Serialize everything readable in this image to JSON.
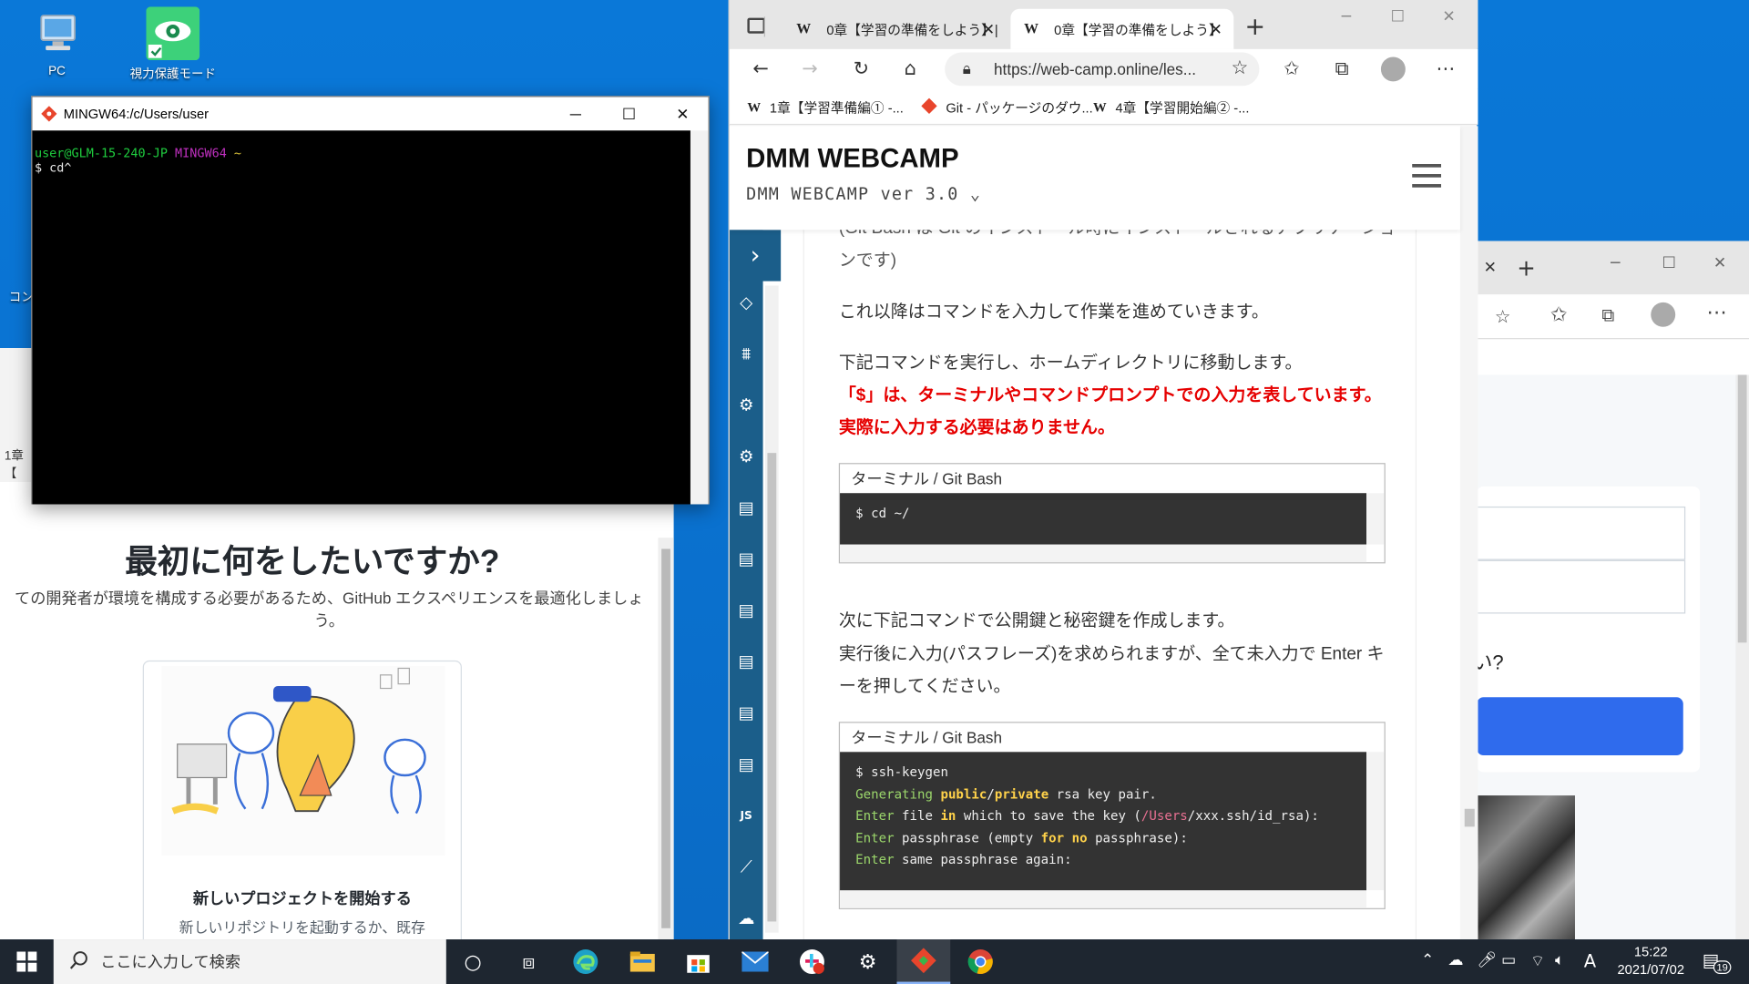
{
  "desktop": {
    "icons": [
      {
        "label": "PC",
        "icon": "computer-icon"
      },
      {
        "label": "視力保護モード",
        "icon": "eye-protection-icon"
      }
    ],
    "partial_label": "コン"
  },
  "github_window": {
    "partial_tab": "1章【",
    "title": "最初に何をしたいですか?",
    "description": "ての開発者が環境を構成する必要があるため、GitHub エクスペリエンスを最適化しましょう。",
    "card_title": "新しいプロジェクトを開始する",
    "card_desc": "新しいリポジトリを起動するか、既存"
  },
  "terminal": {
    "title": "MINGW64:/c/Users/user",
    "prompt_user": "user@GLM-15-240-JP",
    "prompt_env": "MINGW64",
    "prompt_path": "~",
    "command_line": "$ cd^"
  },
  "browser": {
    "tabs": [
      {
        "icon": "W",
        "title": "0章【学習の準備をしよう】|"
      },
      {
        "icon": "W",
        "title": "0章【学習の準備をしよう】"
      }
    ],
    "url": "https://web-camp.online/les...",
    "bookmarks": [
      {
        "icon": "W",
        "label": "1章【学習準備編① -..."
      },
      {
        "icon": "git-icon",
        "label": "Git - パッケージのダウ..."
      },
      {
        "icon": "W",
        "label": "4章【学習開始編② -..."
      }
    ],
    "site": {
      "logo": "DMM WEBCAMP",
      "version": "DMM WEBCAMP ver 3.0"
    },
    "content": {
      "partial_top": "(Git Bash は Git のインストール時にインストールされるアプリケーションです)",
      "p1": "これ以降はコマンドを入力して作業を進めていきます。",
      "p2": "下記コマンドを実行し、ホームディレクトリに移動します。",
      "p2_red": "「$」は、ターミナルやコマンドプロンプトでの入力を表しています。実際に入力する必要はありません。",
      "code1_header": "ターミナル / Git Bash",
      "code1_line": "$ cd ~/",
      "p3_1": "次に下記コマンドで公開鍵と秘密鍵を作成します。",
      "p3_2": "実行後に入力(パスフレーズ)を求められますが、全て未入力で Enter キーを押してください。",
      "code2_header": "ターミナル / Git Bash",
      "code2_lines": [
        "$ ssh-keygen",
        "Generating public/private rsa key pair.",
        "Enter file in which to save the key (/Users/xxx.ssh/id_rsa):",
        "Enter passphrase (empty for no passphrase):",
        "Enter same passphrase again:"
      ]
    }
  },
  "bg_browser": {
    "partial_text": "い?"
  },
  "taskbar": {
    "search_placeholder": "ここに入力して検索",
    "time": "15:22",
    "date": "2021/07/02",
    "ime": "A",
    "notification_count": "19",
    "apps": [
      "cortana-icon",
      "task-view-icon",
      "edge-icon",
      "explorer-icon",
      "store-icon",
      "mail-icon",
      "slack-icon",
      "settings-icon",
      "git-icon",
      "chrome-icon"
    ]
  },
  "colors": {
    "terminal_bg": "#000000",
    "sidebar": "#1b5e8a",
    "alert_red": "#e60000",
    "desktop_blue": "#0a78d8"
  }
}
